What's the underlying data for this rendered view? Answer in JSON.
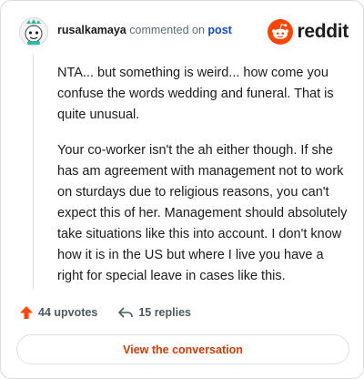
{
  "header": {
    "username": "rusalkamaya",
    "action": "commented on",
    "post_link": "post",
    "brand": "reddit"
  },
  "comment": {
    "paragraphs": [
      "NTA... but something is weird... how come you confuse the words wedding and funeral. That is quite unusual.",
      "Your co-worker isn't the ah either though. If she has am agreement with management not to work on sturdays due to religious reasons, you can't expect this of her. Management should absolutely take situations like this into account. I don't know how it is in the US but where I live you have a right for special leave in cases like this."
    ]
  },
  "actions": {
    "upvotes": "44 upvotes",
    "replies": "15 replies"
  },
  "cta": {
    "label": "View the conversation"
  },
  "colors": {
    "brand_orange": "#ff4500",
    "link_blue": "#0a4bd6",
    "cta_text": "#d93a00",
    "upvote_arrow": "#ff4500"
  },
  "icons": [
    "avatar-icon",
    "reddit-logo-icon",
    "upvote-icon",
    "reply-icon"
  ]
}
